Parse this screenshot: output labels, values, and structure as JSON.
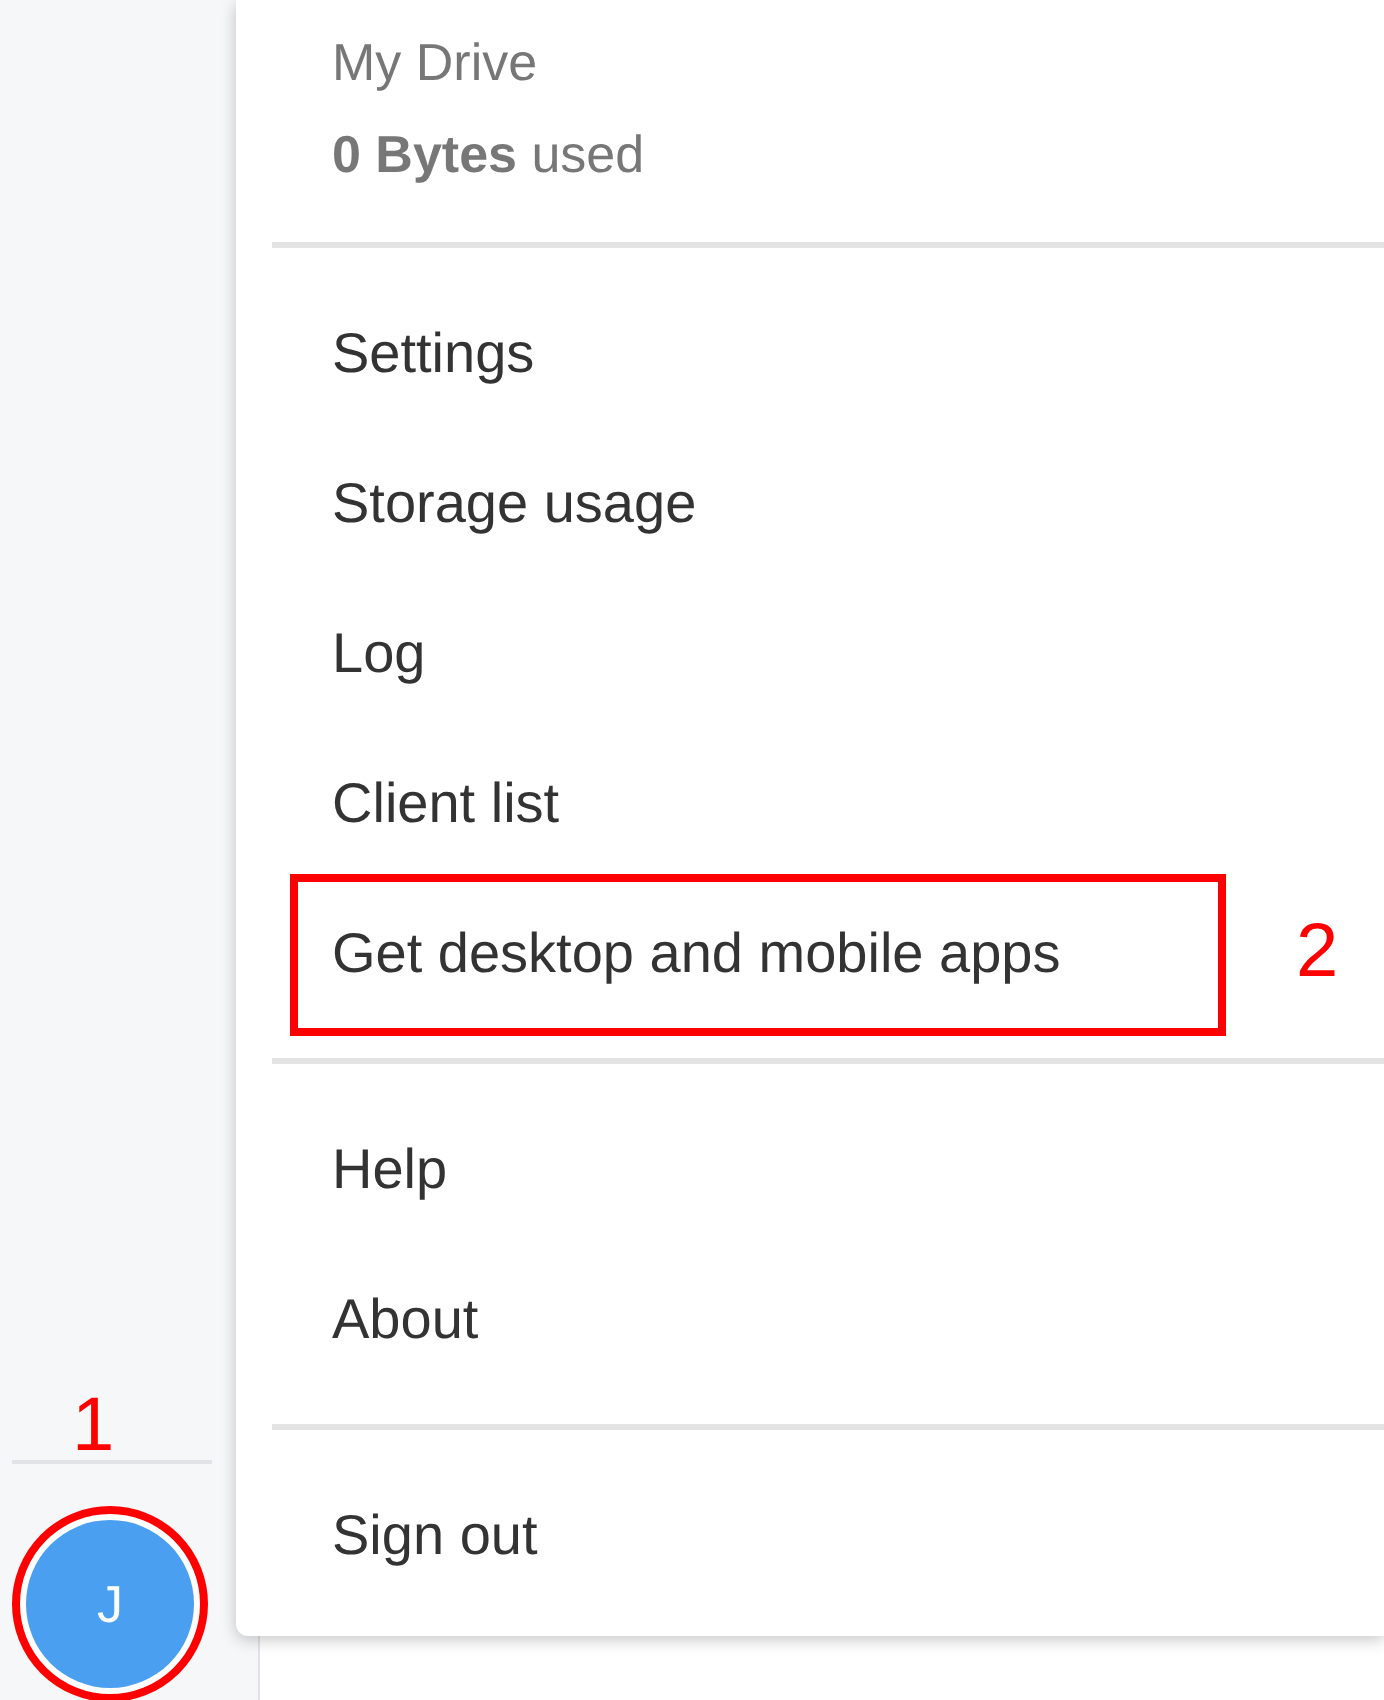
{
  "avatar": {
    "letter": "J",
    "annotation": "1"
  },
  "drive": {
    "title": "My Drive",
    "usage": "**0 Bytes** used"
  },
  "menu_groups": [
    {
      "items": [
        {
          "label": "Settings"
        },
        {
          "label": "Storage usage"
        },
        {
          "label": "Log"
        },
        {
          "label": "Client list"
        },
        {
          "label": "Get desktop and mobile apps",
          "annotation": "2"
        }
      ]
    },
    {
      "items": [
        {
          "label": "Help"
        },
        {
          "label": "About"
        }
      ]
    },
    {
      "items": [
        {
          "label": "Sign out"
        }
      ]
    }
  ]
}
